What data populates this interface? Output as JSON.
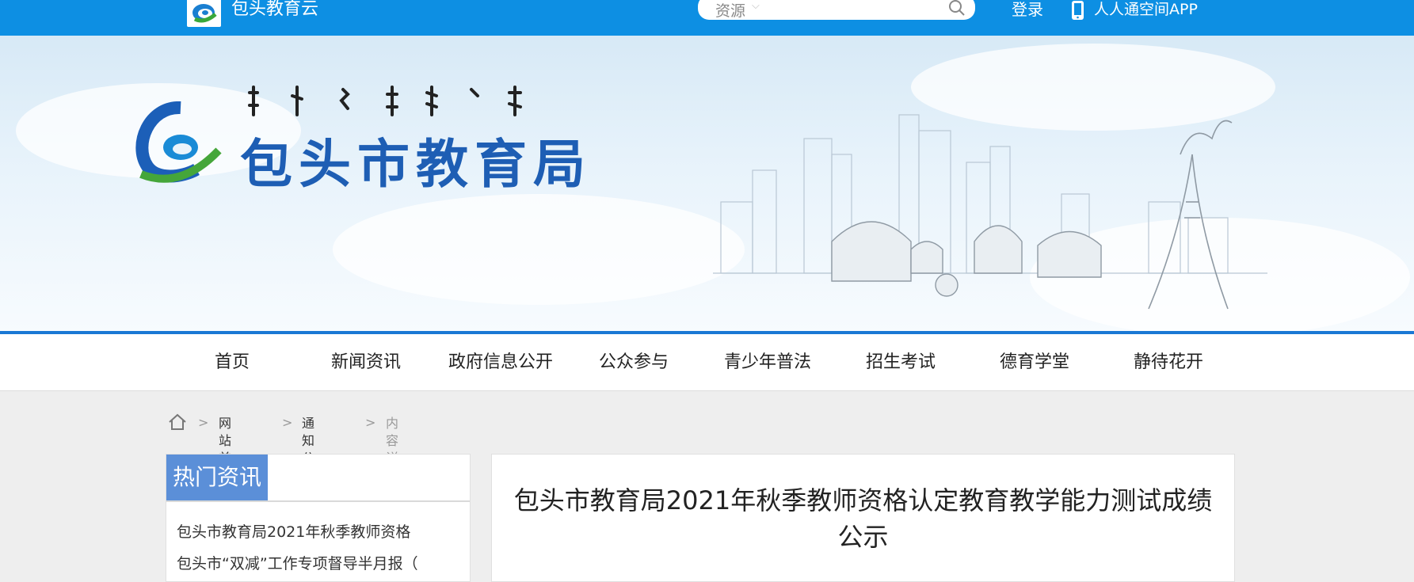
{
  "topbar": {
    "site_name": "包头教育云",
    "search": {
      "category": "资源",
      "placeholder": ""
    },
    "login_label": "登录",
    "app_label": "人人通空间APP",
    "icons": [
      "logo-icon",
      "chevron-down-icon",
      "search-icon",
      "phone-icon"
    ]
  },
  "banner": {
    "title": "包头市教育局",
    "colors": {
      "title": "#1e5eb4",
      "rule": "#1a78d4"
    }
  },
  "nav": {
    "items": [
      {
        "label": "首页"
      },
      {
        "label": "新闻资讯"
      },
      {
        "label": "政府信息公开"
      },
      {
        "label": "公众参与"
      },
      {
        "label": "青少年普法"
      },
      {
        "label": "招生考试"
      },
      {
        "label": "德育学堂"
      },
      {
        "label": "静待花开"
      }
    ]
  },
  "breadcrumb": {
    "separator": ">",
    "items": [
      {
        "label": "网站首页"
      },
      {
        "label": "通知公告"
      }
    ],
    "current": "内容详情"
  },
  "sidebar": {
    "tab_label": "热门资讯",
    "items": [
      {
        "label": "包头市教育局2021年秋季教师资格"
      },
      {
        "label": "包头市“双减”工作专项督导半月报（"
      }
    ]
  },
  "article": {
    "title": "包头市教育局2021年秋季教师资格认定教育教学能力测试成绩公示"
  },
  "colors": {
    "topbar": "#0d8fe3",
    "side_tab": "#5b8fd8",
    "page_bg": "#eeeeee"
  }
}
